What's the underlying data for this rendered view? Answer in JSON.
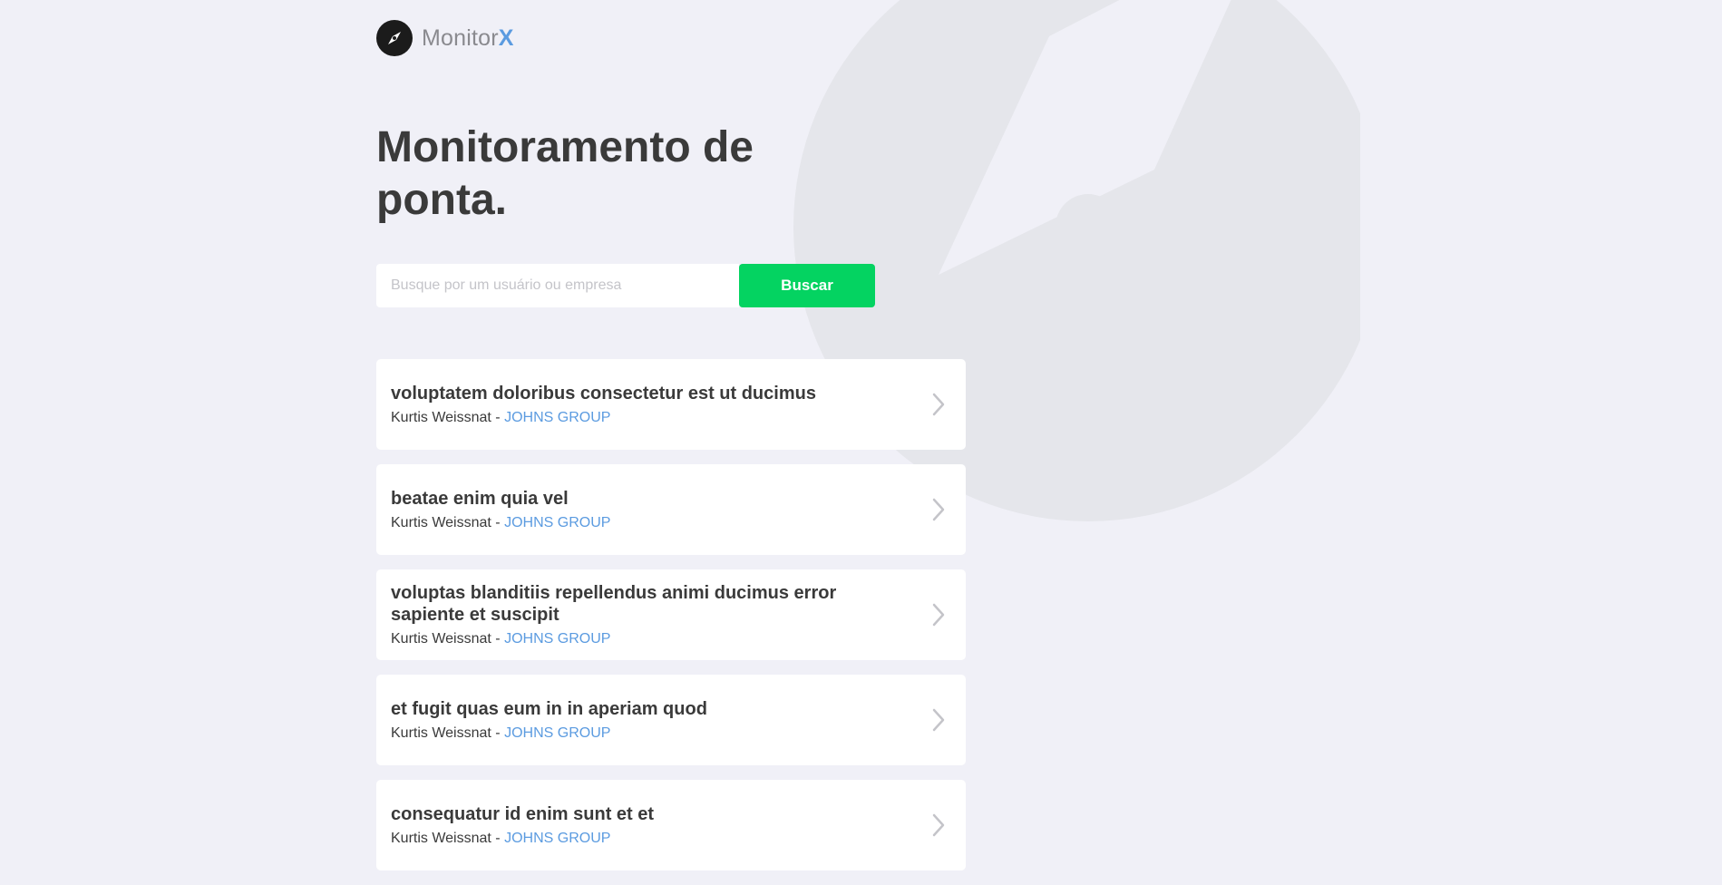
{
  "brand": {
    "name": "Monitor",
    "accent": "X",
    "logo_icon": "compass-icon"
  },
  "hero": {
    "title": "Monitoramento de ponta."
  },
  "search": {
    "placeholder": "Busque por um usuário ou empresa",
    "value": "",
    "button_label": "Buscar"
  },
  "results": [
    {
      "title": "voluptatem doloribus consectetur est ut ducimus",
      "author": "Kurtis Weissnat",
      "separator": " - ",
      "company": "JOHNS GROUP"
    },
    {
      "title": "beatae enim quia vel",
      "author": "Kurtis Weissnat",
      "separator": " - ",
      "company": "JOHNS GROUP"
    },
    {
      "title": "voluptas blanditiis repellendus animi ducimus error sapiente et suscipit",
      "author": "Kurtis Weissnat",
      "separator": " - ",
      "company": "JOHNS GROUP"
    },
    {
      "title": "et fugit quas eum in in aperiam quod",
      "author": "Kurtis Weissnat",
      "separator": " - ",
      "company": "JOHNS GROUP"
    },
    {
      "title": "consequatur id enim sunt et et",
      "author": "Kurtis Weissnat",
      "separator": " - ",
      "company": "JOHNS GROUP"
    }
  ],
  "colors": {
    "background": "#f0f0f7",
    "primary_button": "#04d361",
    "accent_blue": "#5b9be0",
    "text": "#3a3a3a",
    "muted": "#8a8a8f",
    "watermark": "#e5e6eb"
  }
}
